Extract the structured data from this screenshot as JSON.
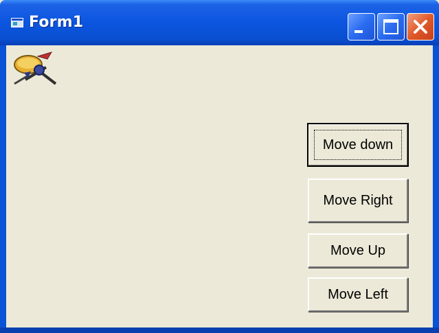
{
  "window": {
    "title": "Form1",
    "icon": "form-window-icon",
    "controls": {
      "minimize": "minimize-icon",
      "maximize": "maximize-icon",
      "close": "close-icon"
    }
  },
  "client": {
    "image": "satellite-icon",
    "buttons": [
      {
        "label": "Move down",
        "focused": true
      },
      {
        "label": "Move Right"
      },
      {
        "label": "Move Up"
      },
      {
        "label": "Move Left"
      }
    ]
  },
  "colors": {
    "titlebar": "#0b55df",
    "client_bg": "#ece9d8",
    "close_button": "#e05a2a"
  }
}
